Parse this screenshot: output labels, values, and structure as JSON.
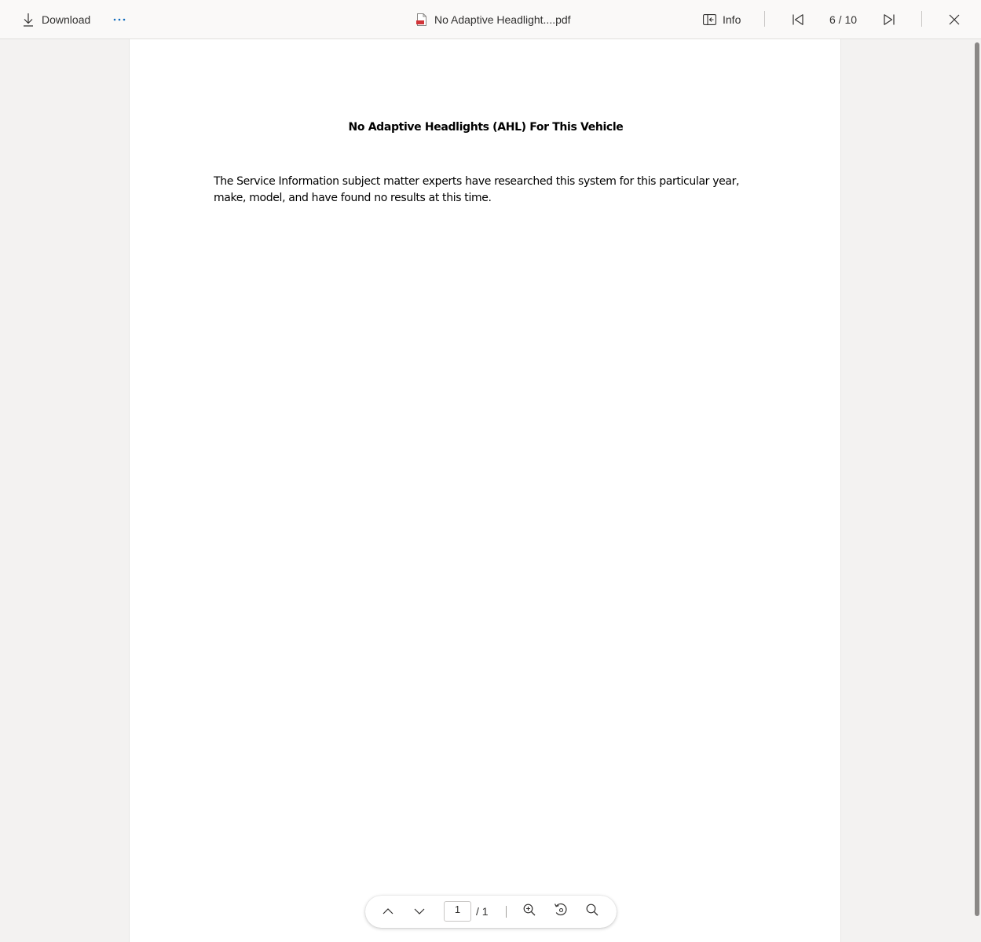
{
  "topbar": {
    "download_label": "Download",
    "more_icon": "more-horizontal-icon",
    "file_icon": "pdf-file-icon",
    "filename": "No Adaptive Headlight....pdf",
    "info_label": "Info",
    "page_counter": "6 / 10"
  },
  "document": {
    "title": "No Adaptive Headlights (AHL) For This Vehicle",
    "body": "The Service Information subject matter experts have researched this system for this particular year, make, model, and have found no results at this time."
  },
  "pdf_toolbar": {
    "page_value": "1",
    "page_total": "/ 1"
  }
}
